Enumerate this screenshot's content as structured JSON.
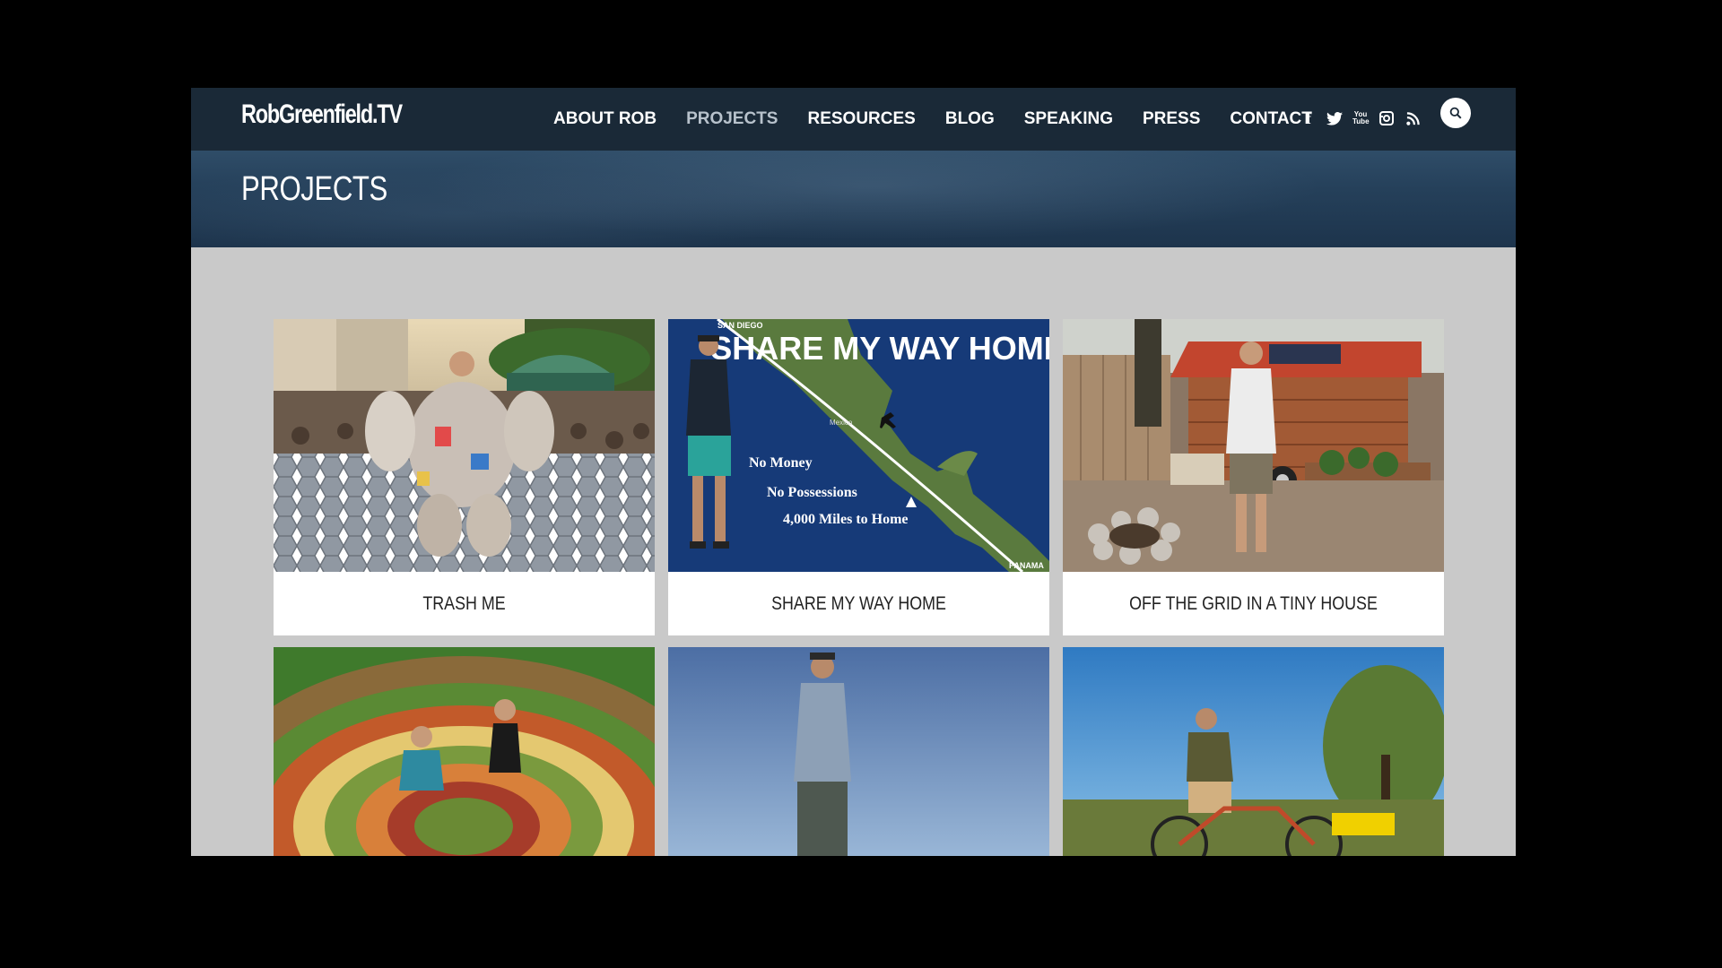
{
  "header": {
    "logo": "RobGreenfield.TV",
    "nav": [
      {
        "label": "ABOUT ROB",
        "active": false
      },
      {
        "label": "PROJECTS",
        "active": true
      },
      {
        "label": "RESOURCES",
        "active": false
      },
      {
        "label": "BLOG",
        "active": false
      },
      {
        "label": "SPEAKING",
        "active": false
      },
      {
        "label": "PRESS",
        "active": false
      },
      {
        "label": "CONTACT",
        "active": false
      }
    ],
    "social": [
      "facebook-icon",
      "twitter-icon",
      "youtube-icon",
      "instagram-icon",
      "rss-icon"
    ],
    "social_glyphs": {
      "facebook": "f",
      "youtube": "You Tube"
    }
  },
  "banner": {
    "title": "PROJECTS"
  },
  "projects": [
    {
      "title": "TRASH ME"
    },
    {
      "title": "SHARE MY WAY HOME",
      "image_text": {
        "headline": "SHARE MY WAY HOME",
        "line1": "No Money",
        "line2": "No Possessions",
        "line3": "4,000 Miles to Home",
        "label_top": "SAN DIEGO",
        "label_bottom": "PANAMA",
        "label_mid": "Mexico"
      }
    },
    {
      "title": "OFF THE GRID IN A TINY HOUSE"
    },
    {
      "title": ""
    },
    {
      "title": ""
    },
    {
      "title": ""
    }
  ],
  "colors": {
    "header": "#1a2937",
    "banner": "#25405a",
    "page_bg": "#c9c9c9",
    "nav_active": "#b8c2cc"
  }
}
